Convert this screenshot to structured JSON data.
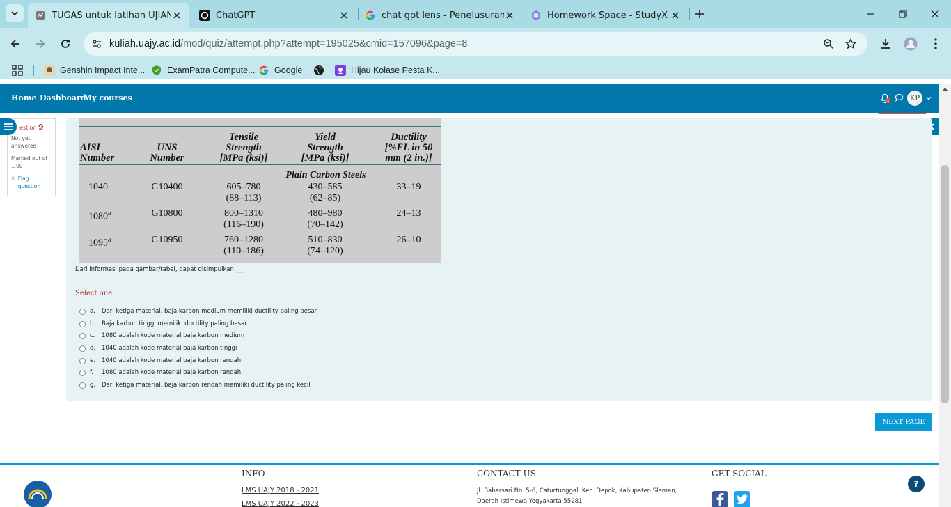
{
  "browser": {
    "tabs": [
      {
        "title": "TUGAS untuk latihan UJIAN AKHIR",
        "icon": "moodle-icon",
        "active": true
      },
      {
        "title": "ChatGPT",
        "icon": "chatgpt-icon",
        "active": false
      },
      {
        "title": "chat gpt lens - Penelusuran Google",
        "icon": "google-icon",
        "active": false
      },
      {
        "title": "Homework Space - StudyX",
        "icon": "studyx-icon",
        "active": false
      }
    ],
    "url_host": "kuliah.uajy.ac.id",
    "url_path": "/mod/quiz/attempt.php?attempt=195025&cmid=157096&page=8",
    "bookmarks": [
      {
        "label": "Genshin Impact Inte..."
      },
      {
        "label": "ExamPatra Compute..."
      },
      {
        "label": "Google"
      },
      {
        "label": ""
      },
      {
        "label": "Hijau Kolase Pesta K..."
      }
    ]
  },
  "navbar": {
    "links": [
      "Home",
      "Dashboard",
      "My courses"
    ],
    "avatar_initials": "KP",
    "notification_count": "1"
  },
  "question_info": {
    "number_prefix": "estion",
    "number": "9",
    "status": "Not yet answered",
    "mark": "Marked out of 1.00",
    "flag": "Flag question"
  },
  "table_image": {
    "headers": {
      "aisi": "AISI Number",
      "uns": "UNS Number",
      "tensile": "Tensile Strength [MPa (ksi)]",
      "yield": "Yield Strength [MPa (ksi)]",
      "ductility": "Ductility [%EL in 50 mm (2 in.)]"
    },
    "section": "Plain Carbon Steels",
    "rows": [
      {
        "aisi": "1040",
        "uns": "G10400",
        "tensile": "605–780",
        "tensile_ksi": "(88–113)",
        "yield": "430–585",
        "yield_ksi": "(62–85)",
        "ductility": "33–19"
      },
      {
        "aisi": "1080",
        "sup": "a",
        "uns": "G10800",
        "tensile": "800–1310",
        "tensile_ksi": "(116–190)",
        "yield": "480–980",
        "yield_ksi": "(70–142)",
        "ductility": "24–13"
      },
      {
        "aisi": "1095",
        "sup": "a",
        "uns": "G10950",
        "tensile": "760–1280",
        "tensile_ksi": "(110–186)",
        "yield": "510–830",
        "yield_ksi": "(74–120)",
        "ductility": "26–10"
      }
    ]
  },
  "question": {
    "text": "Dari informasi pada gambar/tabel, dapat disimpulkan ___",
    "select_one": "Select one:",
    "options": [
      {
        "letter": "a.",
        "text": "Dari ketiga material, baja karbon medium memiliki ductility paling besar"
      },
      {
        "letter": "b.",
        "text": "Baja karbon tinggi memiliki ductility paling besar"
      },
      {
        "letter": "c.",
        "text": "1080 adalah kode material baja karbon medium"
      },
      {
        "letter": "d.",
        "text": "1040 adalah kode material baja karbon tinggi"
      },
      {
        "letter": "e.",
        "text": "1040 adalah kode material baja karbon rendah"
      },
      {
        "letter": "f.",
        "text": "1080 adalah kode material baja karbon rendah"
      },
      {
        "letter": "g.",
        "text": "Dari ketiga material, baja karbon rendah memiliki ductility paling kecil"
      }
    ]
  },
  "next_button": "NEXT PAGE",
  "footer": {
    "info_heading": "INFO",
    "info_links": [
      "LMS UAJY 2018 - 2021",
      "LMS UAJY 2022 - 2023"
    ],
    "contact_heading": "CONTACT US",
    "address": "Jl. Babarsari No. 5-6, Caturtunggal, Kec. Depok, Kabupaten Sleman, Daerah Istimewa Yogyakarta 55281",
    "social_heading": "GET SOCIAL",
    "help": "?"
  },
  "colors": {
    "navbar": "#0078ab",
    "tab_bar": "#a8dbe3",
    "question_bg": "#e7f2f5",
    "button": "#0a9ad6",
    "accent_red": "#b32d2e"
  }
}
